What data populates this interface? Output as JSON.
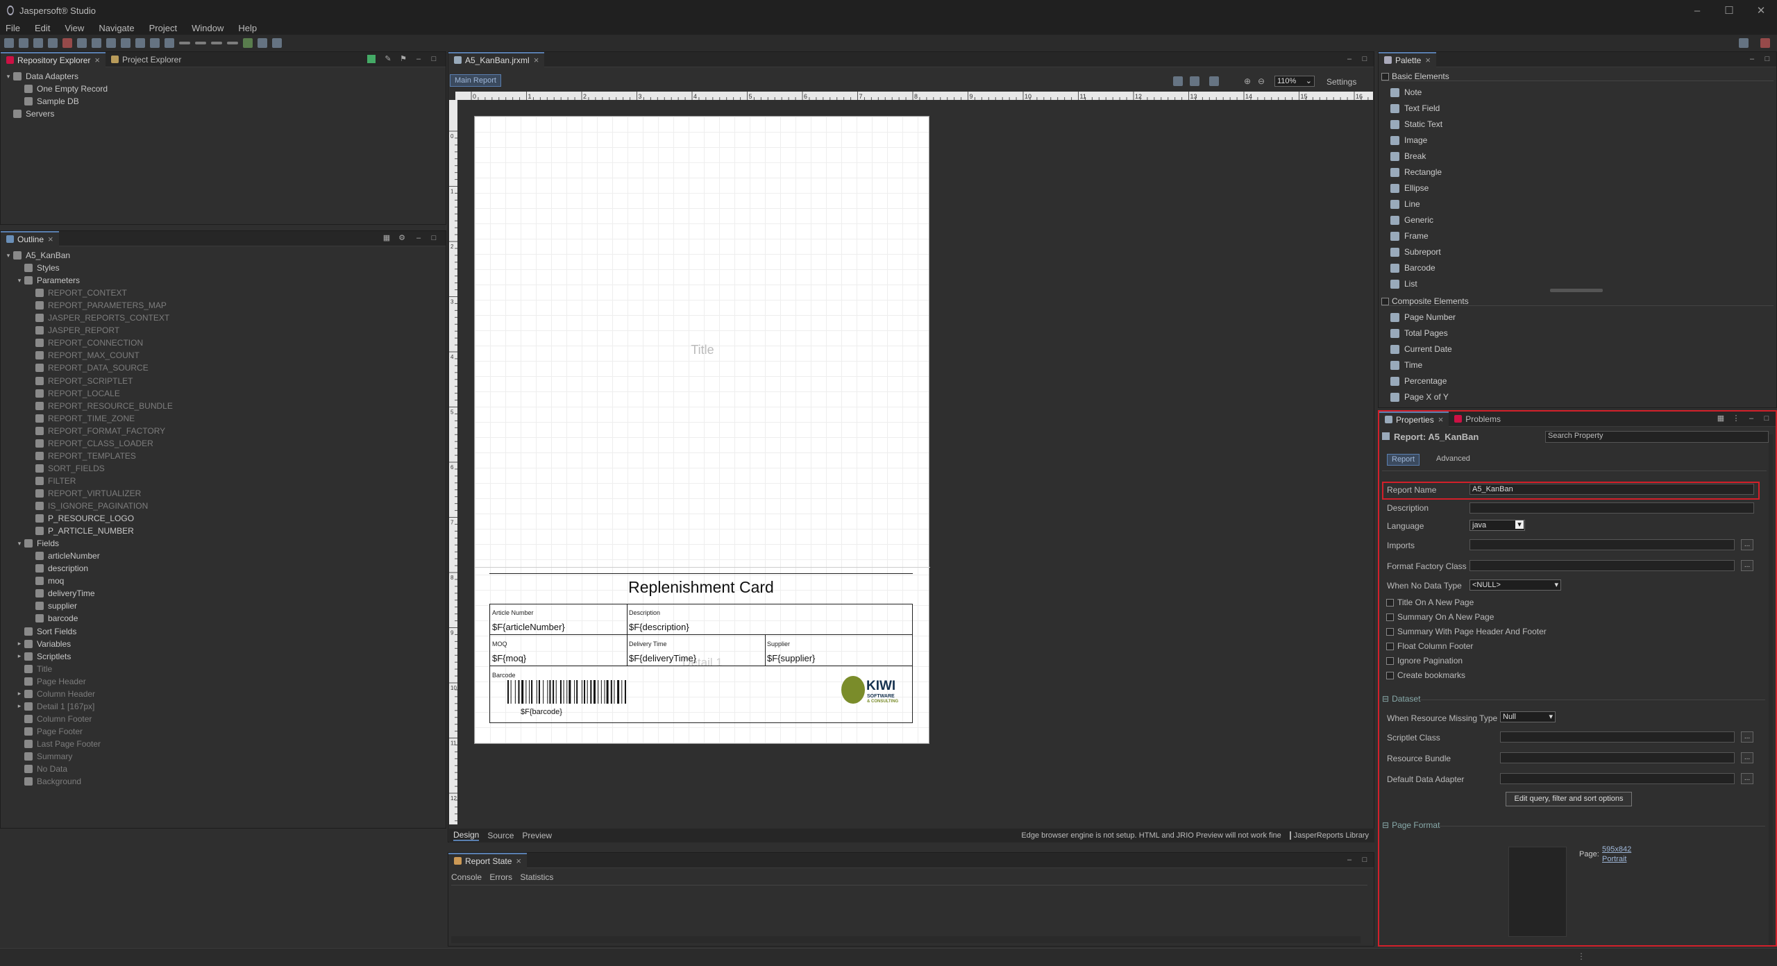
{
  "app": {
    "title": "Jaspersoft® Studio"
  },
  "menu": [
    "File",
    "Edit",
    "View",
    "Navigate",
    "Project",
    "Window",
    "Help"
  ],
  "repo": {
    "tabs": [
      "Repository Explorer",
      "Project Explorer"
    ],
    "items": [
      {
        "label": "Data Adapters",
        "level": 0,
        "twisty": "v"
      },
      {
        "label": "One Empty Record",
        "level": 1,
        "twisty": ""
      },
      {
        "label": "Sample DB",
        "level": 1,
        "twisty": ""
      },
      {
        "label": "Servers",
        "level": 0,
        "twisty": ""
      }
    ]
  },
  "outline": {
    "tab": "Outline",
    "items": [
      {
        "label": "A5_KanBan",
        "level": 0,
        "twisty": "v",
        "dim": false
      },
      {
        "label": "Styles",
        "level": 1,
        "twisty": "",
        "dim": false
      },
      {
        "label": "Parameters",
        "level": 1,
        "twisty": "v",
        "dim": false
      },
      {
        "label": "REPORT_CONTEXT",
        "level": 2,
        "twisty": "",
        "dim": true
      },
      {
        "label": "REPORT_PARAMETERS_MAP",
        "level": 2,
        "twisty": "",
        "dim": true
      },
      {
        "label": "JASPER_REPORTS_CONTEXT",
        "level": 2,
        "twisty": "",
        "dim": true
      },
      {
        "label": "JASPER_REPORT",
        "level": 2,
        "twisty": "",
        "dim": true
      },
      {
        "label": "REPORT_CONNECTION",
        "level": 2,
        "twisty": "",
        "dim": true
      },
      {
        "label": "REPORT_MAX_COUNT",
        "level": 2,
        "twisty": "",
        "dim": true
      },
      {
        "label": "REPORT_DATA_SOURCE",
        "level": 2,
        "twisty": "",
        "dim": true
      },
      {
        "label": "REPORT_SCRIPTLET",
        "level": 2,
        "twisty": "",
        "dim": true
      },
      {
        "label": "REPORT_LOCALE",
        "level": 2,
        "twisty": "",
        "dim": true
      },
      {
        "label": "REPORT_RESOURCE_BUNDLE",
        "level": 2,
        "twisty": "",
        "dim": true
      },
      {
        "label": "REPORT_TIME_ZONE",
        "level": 2,
        "twisty": "",
        "dim": true
      },
      {
        "label": "REPORT_FORMAT_FACTORY",
        "level": 2,
        "twisty": "",
        "dim": true
      },
      {
        "label": "REPORT_CLASS_LOADER",
        "level": 2,
        "twisty": "",
        "dim": true
      },
      {
        "label": "REPORT_TEMPLATES",
        "level": 2,
        "twisty": "",
        "dim": true
      },
      {
        "label": "SORT_FIELDS",
        "level": 2,
        "twisty": "",
        "dim": true
      },
      {
        "label": "FILTER",
        "level": 2,
        "twisty": "",
        "dim": true
      },
      {
        "label": "REPORT_VIRTUALIZER",
        "level": 2,
        "twisty": "",
        "dim": true
      },
      {
        "label": "IS_IGNORE_PAGINATION",
        "level": 2,
        "twisty": "",
        "dim": true
      },
      {
        "label": "P_RESOURCE_LOGO",
        "level": 2,
        "twisty": "",
        "dim": false
      },
      {
        "label": "P_ARTICLE_NUMBER",
        "level": 2,
        "twisty": "",
        "dim": false
      },
      {
        "label": "Fields",
        "level": 1,
        "twisty": "v",
        "dim": false
      },
      {
        "label": "articleNumber",
        "level": 2,
        "twisty": "",
        "dim": false
      },
      {
        "label": "description",
        "level": 2,
        "twisty": "",
        "dim": false
      },
      {
        "label": "moq",
        "level": 2,
        "twisty": "",
        "dim": false
      },
      {
        "label": "deliveryTime",
        "level": 2,
        "twisty": "",
        "dim": false
      },
      {
        "label": "supplier",
        "level": 2,
        "twisty": "",
        "dim": false
      },
      {
        "label": "barcode",
        "level": 2,
        "twisty": "",
        "dim": false
      },
      {
        "label": "Sort Fields",
        "level": 1,
        "twisty": "",
        "dim": false
      },
      {
        "label": "Variables",
        "level": 1,
        "twisty": ">",
        "dim": false
      },
      {
        "label": "Scriptlets",
        "level": 1,
        "twisty": ">",
        "dim": false
      },
      {
        "label": "Title",
        "level": 1,
        "twisty": "",
        "dim": true
      },
      {
        "label": "Page Header",
        "level": 1,
        "twisty": "",
        "dim": true
      },
      {
        "label": "Column Header",
        "level": 1,
        "twisty": ">",
        "dim": true
      },
      {
        "label": "Detail 1 [167px]",
        "level": 1,
        "twisty": ">",
        "dim": true
      },
      {
        "label": "Column Footer",
        "level": 1,
        "twisty": "",
        "dim": true
      },
      {
        "label": "Page Footer",
        "level": 1,
        "twisty": "",
        "dim": true
      },
      {
        "label": "Last Page Footer",
        "level": 1,
        "twisty": "",
        "dim": true
      },
      {
        "label": "Summary",
        "level": 1,
        "twisty": "",
        "dim": true
      },
      {
        "label": "No Data",
        "level": 1,
        "twisty": "",
        "dim": true
      },
      {
        "label": "Background",
        "level": 1,
        "twisty": "",
        "dim": true
      }
    ]
  },
  "editor": {
    "tab": "A5_KanBan.jrxml",
    "main_report": "Main Report",
    "zoom": "110%",
    "settings": "Settings",
    "ruler_h": [
      "0",
      "1",
      "2",
      "3",
      "4",
      "5",
      "6",
      "7",
      "8",
      "9",
      "10",
      "11",
      "12",
      "13",
      "14",
      "15",
      "16"
    ],
    "ruler_v": [
      "0",
      "1",
      "2",
      "3",
      "4",
      "5",
      "6",
      "7",
      "8",
      "9",
      "10",
      "11",
      "12"
    ],
    "bottom_tabs": [
      "Design",
      "Source",
      "Preview"
    ],
    "status_msg": "Edge browser engine is not setup. HTML and JRIO Preview will not work fine",
    "status_lib": "JasperReports Library"
  },
  "report": {
    "title_band": "Title",
    "detail_band": "Detail 1",
    "heading": "Replenishment Card",
    "cells": [
      {
        "label": "Article Number",
        "value": "$F{articleNumber}"
      },
      {
        "label": "Description",
        "value": "$F{description}"
      },
      {
        "label": "MOQ",
        "value": "$F{moq}"
      },
      {
        "label": "Delivery Time",
        "value": "$F{deliveryTime}"
      },
      {
        "label": "Supplier",
        "value": "$F{supplier}"
      }
    ],
    "barcode_label": "Barcode",
    "barcode_value": "$F{barcode}",
    "logo_big": "KIWI",
    "logo_small1": "SOFTWARE",
    "logo_small2": "& CONSULTING"
  },
  "report_state": {
    "tab": "Report State",
    "tabs": [
      "Console",
      "Errors",
      "Statistics"
    ]
  },
  "palette": {
    "tab": "Palette",
    "basic_title": "Basic Elements",
    "basic": [
      "Note",
      "Text Field",
      "Static Text",
      "Image",
      "Break",
      "Rectangle",
      "Ellipse",
      "Line",
      "Generic",
      "Frame",
      "Subreport",
      "Barcode",
      "List"
    ],
    "composite_title": "Composite Elements",
    "composite": [
      "Page Number",
      "Total Pages",
      "Current Date",
      "Time",
      "Percentage",
      "Page X of Y"
    ]
  },
  "properties": {
    "tabs": [
      "Properties",
      "Problems"
    ],
    "header": "Report: A5_KanBan",
    "search_placeholder": "Search Property",
    "subtabs": [
      "Report",
      "Advanced"
    ],
    "report_name_label": "Report Name",
    "report_name_value": "A5_KanBan",
    "description_label": "Description",
    "language_label": "Language",
    "language_value": "java",
    "imports_label": "Imports",
    "format_factory_label": "Format Factory Class",
    "no_data_label": "When No Data Type",
    "no_data_value": "<NULL>",
    "checkboxes": [
      "Title On A New Page",
      "Summary On A New Page",
      "Summary With Page Header And Footer",
      "Float Column Footer",
      "Ignore Pagination",
      "Create bookmarks"
    ],
    "dataset_title": "Dataset",
    "missing_type_label": "When Resource Missing Type",
    "missing_type_value": "Null",
    "scriptlet_label": "Scriptlet Class",
    "bundle_label": "Resource Bundle",
    "adapter_label": "Default Data Adapter",
    "edit_query_button": "Edit query, filter and sort options",
    "page_format_title": "Page Format",
    "page_label": "Page:",
    "page_size": "595x842",
    "page_orientation": "Portrait",
    "dots": "..."
  },
  "colors": {
    "highlight": "#d2202a",
    "accent": "#5a7fb0"
  }
}
